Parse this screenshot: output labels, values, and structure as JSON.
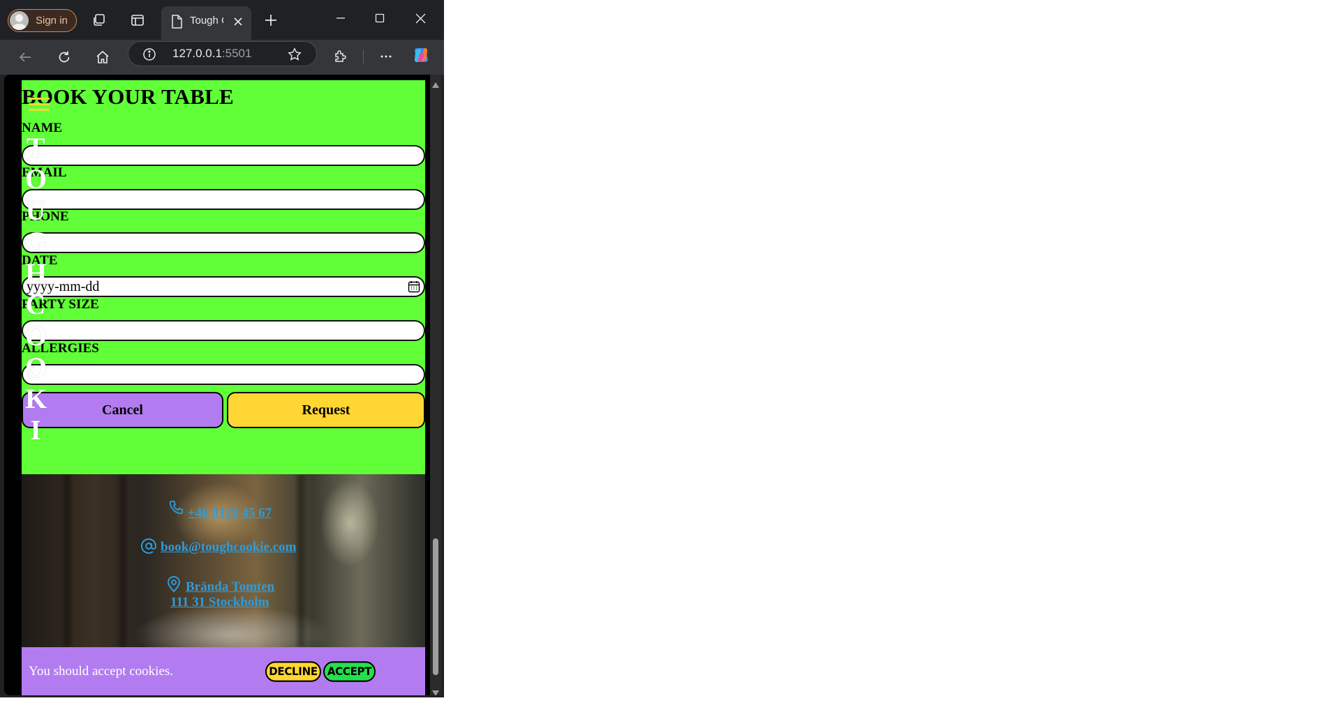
{
  "browser": {
    "signin_label": "Sign in",
    "tab_title": "Tough C",
    "url_host": "127.0.0.1",
    "url_port": ":5501"
  },
  "brand_vertical": [
    "T",
    "O",
    "U",
    "G",
    "H",
    "C",
    "O",
    "O",
    "K",
    "I"
  ],
  "booking": {
    "title": "BOOK YOUR TABLE",
    "fields": {
      "name_label": "NAME",
      "email_label": "EMAIL",
      "phone_label": "PHONE",
      "date_label": "DATE",
      "date_placeholder": "yyyy-mm-dd",
      "party_label": "PARTY SIZE",
      "allergies_label": "ALLERGIES"
    },
    "cancel_label": "Cancel",
    "request_label": "Request",
    "colors": {
      "section_bg": "#60ff38",
      "cancel_bg": "#b27cf0",
      "request_bg": "#ffd633"
    }
  },
  "contact": {
    "phone": "+46 8123 45 67",
    "email": "book@toughcookie.com",
    "address_line1": "Brända Tomten",
    "address_line2": "111 31 Stockholm",
    "link_color": "#2d9cdb"
  },
  "cookie_banner": {
    "message": "You should accept cookies.",
    "decline_label": "DECLINE",
    "accept_label": "ACCEPT",
    "colors": {
      "banner_bg": "#b27cf0",
      "decline_bg": "#ffd633",
      "accept_bg": "#24e04a"
    }
  }
}
